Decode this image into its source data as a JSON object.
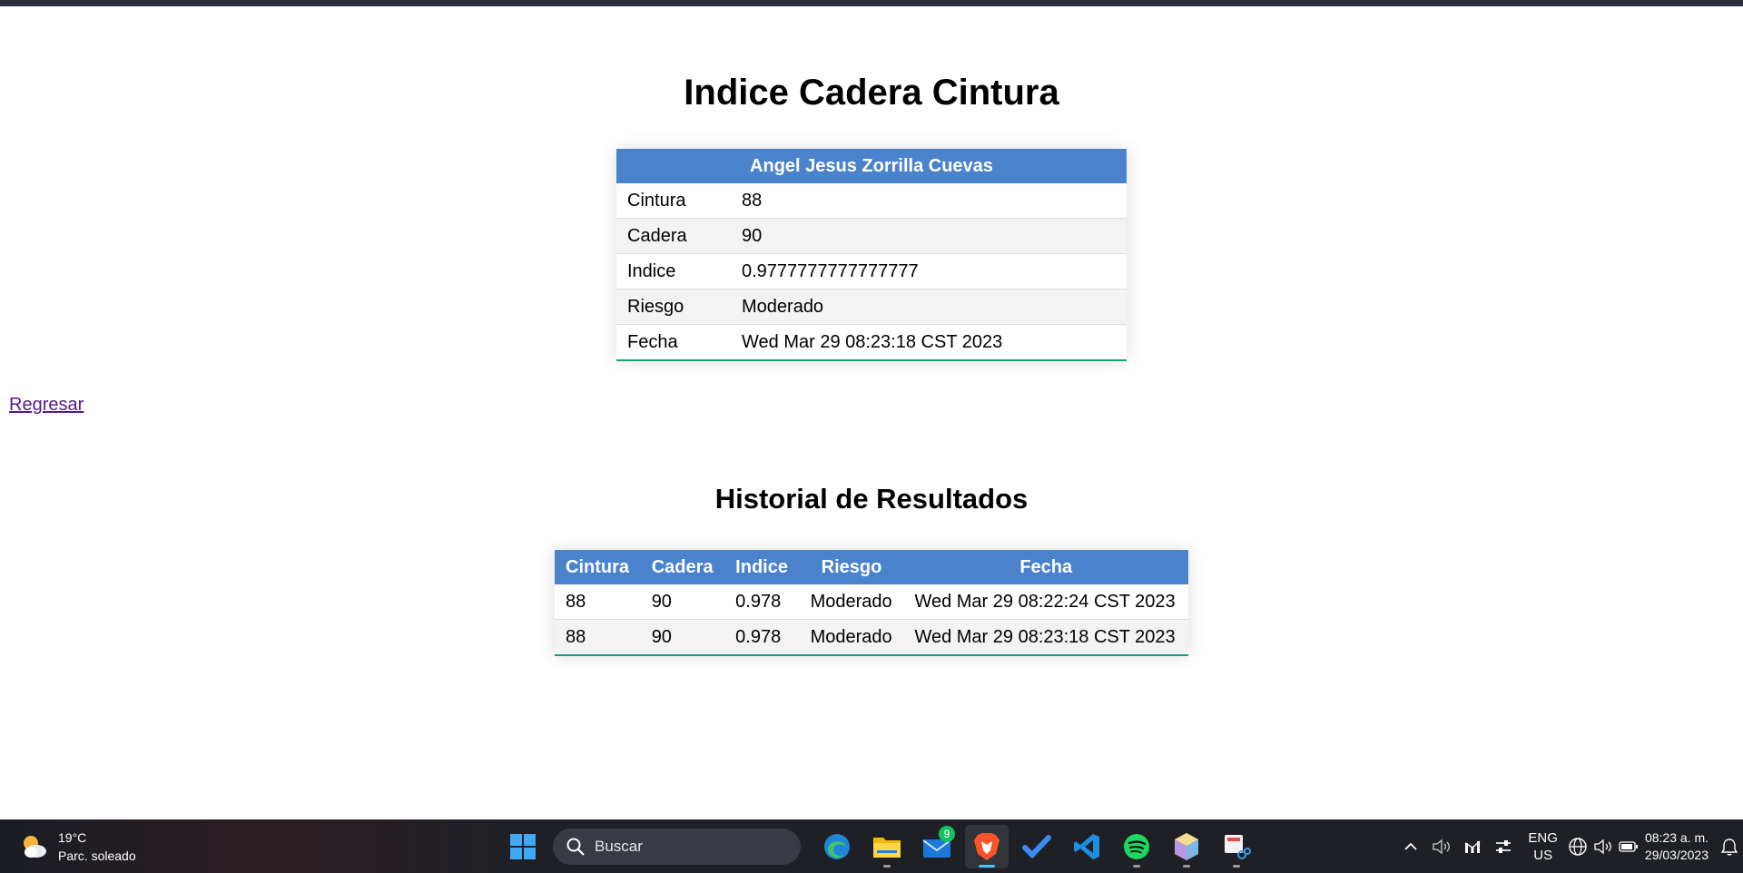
{
  "main": {
    "title": "Indice Cadera Cintura",
    "result": {
      "name": "Angel Jesus Zorrilla Cuevas",
      "rows": [
        {
          "label": "Cintura",
          "value": "88"
        },
        {
          "label": "Cadera",
          "value": "90"
        },
        {
          "label": "Indice",
          "value": "0.9777777777777777"
        },
        {
          "label": "Riesgo",
          "value": "Moderado"
        },
        {
          "label": "Fecha",
          "value": "Wed Mar 29 08:23:18 CST 2023"
        }
      ]
    },
    "back_link": "Regresar",
    "history": {
      "title": "Historial de Resultados",
      "headers": [
        "Cintura",
        "Cadera",
        "Indice",
        "Riesgo",
        "Fecha"
      ],
      "rows": [
        [
          "88",
          "90",
          "0.978",
          "Moderado",
          "Wed Mar 29 08:22:24 CST 2023"
        ],
        [
          "88",
          "90",
          "0.978",
          "Moderado",
          "Wed Mar 29 08:23:18 CST 2023"
        ]
      ]
    }
  },
  "taskbar": {
    "weather": {
      "temp": "19°C",
      "desc": "Parc. soleado",
      "icon": "partly-sunny-icon"
    },
    "search_placeholder": "Buscar",
    "apps": [
      {
        "name": "edge-icon"
      },
      {
        "name": "file-explorer-icon"
      },
      {
        "name": "mail-icon",
        "badge": "9"
      },
      {
        "name": "brave-browser-icon"
      },
      {
        "name": "todo-icon"
      },
      {
        "name": "vscode-icon"
      },
      {
        "name": "spotify-icon"
      },
      {
        "name": "netbeans-icon"
      },
      {
        "name": "snipping-tool-icon"
      }
    ],
    "lang": {
      "line1": "ENG",
      "line2": "US"
    },
    "clock": {
      "time": "08:23 a. m.",
      "date": "29/03/2023"
    }
  },
  "colors": {
    "header_bg": "#4a82cc",
    "row_alt": "#f3f3f3",
    "table_bottom_border": "#12a07a",
    "link": "#551a8b",
    "taskbar_bg": "#1e2026"
  }
}
